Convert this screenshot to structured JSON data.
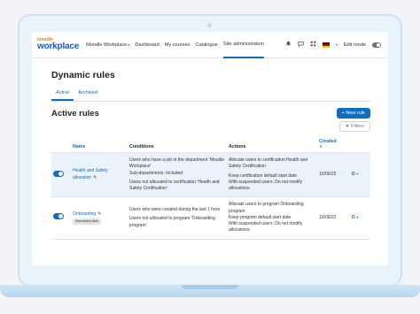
{
  "brand": {
    "small": "moodle",
    "big": "workplace"
  },
  "nav": {
    "workplace_menu": "Moodle Workplace",
    "items": [
      {
        "label": "Dashboard",
        "active": false
      },
      {
        "label": "My courses",
        "active": false
      },
      {
        "label": "Catalogue",
        "active": false
      },
      {
        "label": "Site administration",
        "active": true
      }
    ],
    "edit_mode_label": "Edit mode"
  },
  "page": {
    "title": "Dynamic rules",
    "tabs": [
      {
        "label": "Active",
        "active": true
      },
      {
        "label": "Archived",
        "active": false
      }
    ],
    "section_title": "Active rules",
    "new_rule_label": "+ New rule",
    "filters_label": "Filters"
  },
  "table": {
    "headers": {
      "name": "Name",
      "conditions": "Conditions",
      "actions": "Actions",
      "created": "Created"
    },
    "rows": [
      {
        "name": "Health and Safety allocation",
        "badge": "",
        "conditions": [
          "Users who have a job in the department 'Moodle Workplace'",
          "Sub-departments: Included",
          "Users not allocated to certification 'Health and Safety Certification'"
        ],
        "actions": [
          "Allocate users to certification Health and Safety Certification",
          "Keep certification default start date",
          "With suspended users: Do not modify allocations"
        ],
        "created": "10/06/22"
      },
      {
        "name": "Onboarding",
        "badge": "Scheduled task",
        "conditions": [
          "Users who were created during the last 1 hour",
          "Users not allocated to program 'Onboarding program'"
        ],
        "actions": [
          "Allocate users to program Onboarding program",
          "Keep program default start date",
          "With suspended users: Do not modify allocations"
        ],
        "created": "10/06/22"
      }
    ]
  },
  "colors": {
    "primary": "#0f6cbf",
    "brand_orange": "#f98012",
    "row_highlight": "#eaf3fb"
  }
}
